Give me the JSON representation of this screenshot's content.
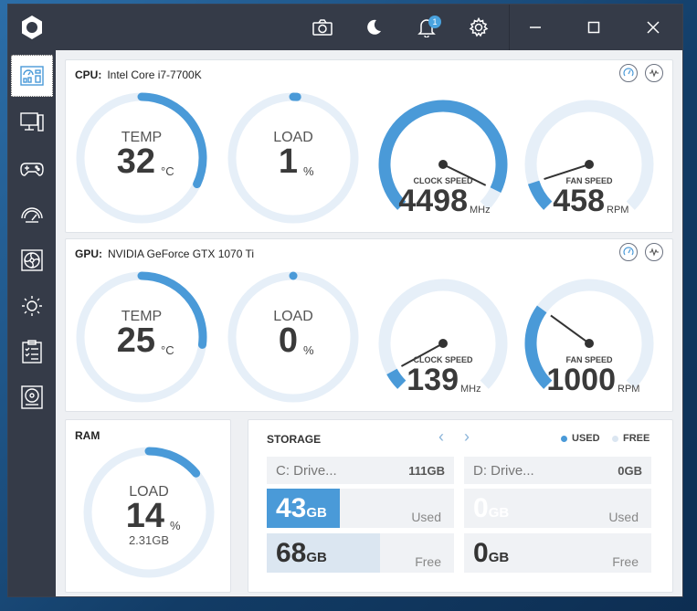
{
  "titlebar": {
    "notification_count": "1",
    "icons": [
      "camera-icon",
      "moon-icon",
      "bell-icon",
      "gear-icon",
      "minimize-icon",
      "maximize-icon",
      "close-icon"
    ]
  },
  "sidebar": {
    "items": [
      {
        "name": "dashboard",
        "active": true
      },
      {
        "name": "system"
      },
      {
        "name": "gaming"
      },
      {
        "name": "overclock"
      },
      {
        "name": "cooling"
      },
      {
        "name": "lighting"
      },
      {
        "name": "tasks"
      },
      {
        "name": "storage"
      }
    ]
  },
  "cpu": {
    "label": "CPU:",
    "model": "Intel Core i7-7700K",
    "temp_label": "TEMP",
    "temp_value": "32",
    "temp_unit": "°C",
    "temp_fraction": 0.32,
    "load_label": "LOAD",
    "load_value": "1",
    "load_unit": "%",
    "load_fraction": 0.01,
    "clock_label": "CLOCK SPEED",
    "clock_value": "4498",
    "clock_unit": "MHz",
    "clock_fraction": 0.93,
    "fan_label": "FAN SPEED",
    "fan_value": "458",
    "fan_unit": "RPM",
    "fan_fraction": 0.1
  },
  "gpu": {
    "label": "GPU:",
    "model": "NVIDIA GeForce GTX 1070 Ti",
    "temp_label": "TEMP",
    "temp_value": "25",
    "temp_unit": "°C",
    "temp_fraction": 0.27,
    "load_label": "LOAD",
    "load_value": "0",
    "load_unit": "%",
    "load_fraction": 0.0,
    "clock_label": "CLOCK SPEED",
    "clock_value": "139",
    "clock_unit": "MHz",
    "clock_fraction": 0.06,
    "fan_label": "FAN SPEED",
    "fan_value": "1000",
    "fan_unit": "RPM",
    "fan_fraction": 0.3
  },
  "ram": {
    "title": "RAM",
    "load_label": "LOAD",
    "load_value": "14",
    "load_unit": "%",
    "load_fraction": 0.14,
    "used": "2.31GB"
  },
  "storage": {
    "title": "STORAGE",
    "legend_used": "USED",
    "legend_free": "FREE",
    "colors": {
      "used": "#4a9ad8",
      "free": "#dbe6f1"
    },
    "drives": [
      {
        "name": "C: Drive...",
        "size": "111GB",
        "used_value": "43",
        "used_unit": "GB",
        "used_label": "Used",
        "free_value": "68",
        "free_unit": "GB",
        "free_label": "Free",
        "used_fraction": 0.39
      },
      {
        "name": "D: Drive...",
        "size": "0GB",
        "used_value": "0",
        "used_unit": "GB",
        "used_label": "Used",
        "free_value": "0",
        "free_unit": "GB",
        "free_label": "Free",
        "used_fraction": 0.0
      }
    ]
  },
  "colors": {
    "accent": "#4a9ad8",
    "track": "#e6eff8",
    "sidebar": "#353b48"
  }
}
